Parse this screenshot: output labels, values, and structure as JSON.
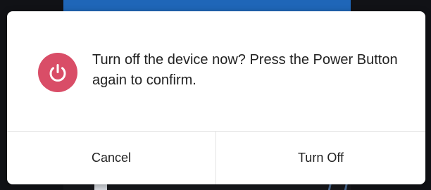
{
  "dialog": {
    "message": "Turn off the device now? Press the Power Button again to confirm.",
    "icon": "power-icon",
    "buttons": {
      "cancel": "Cancel",
      "turn_off": "Turn Off"
    }
  },
  "colors": {
    "icon_background": "#d94d67",
    "dialog_background": "#ffffff",
    "backdrop_blue": "#1f66b8"
  }
}
